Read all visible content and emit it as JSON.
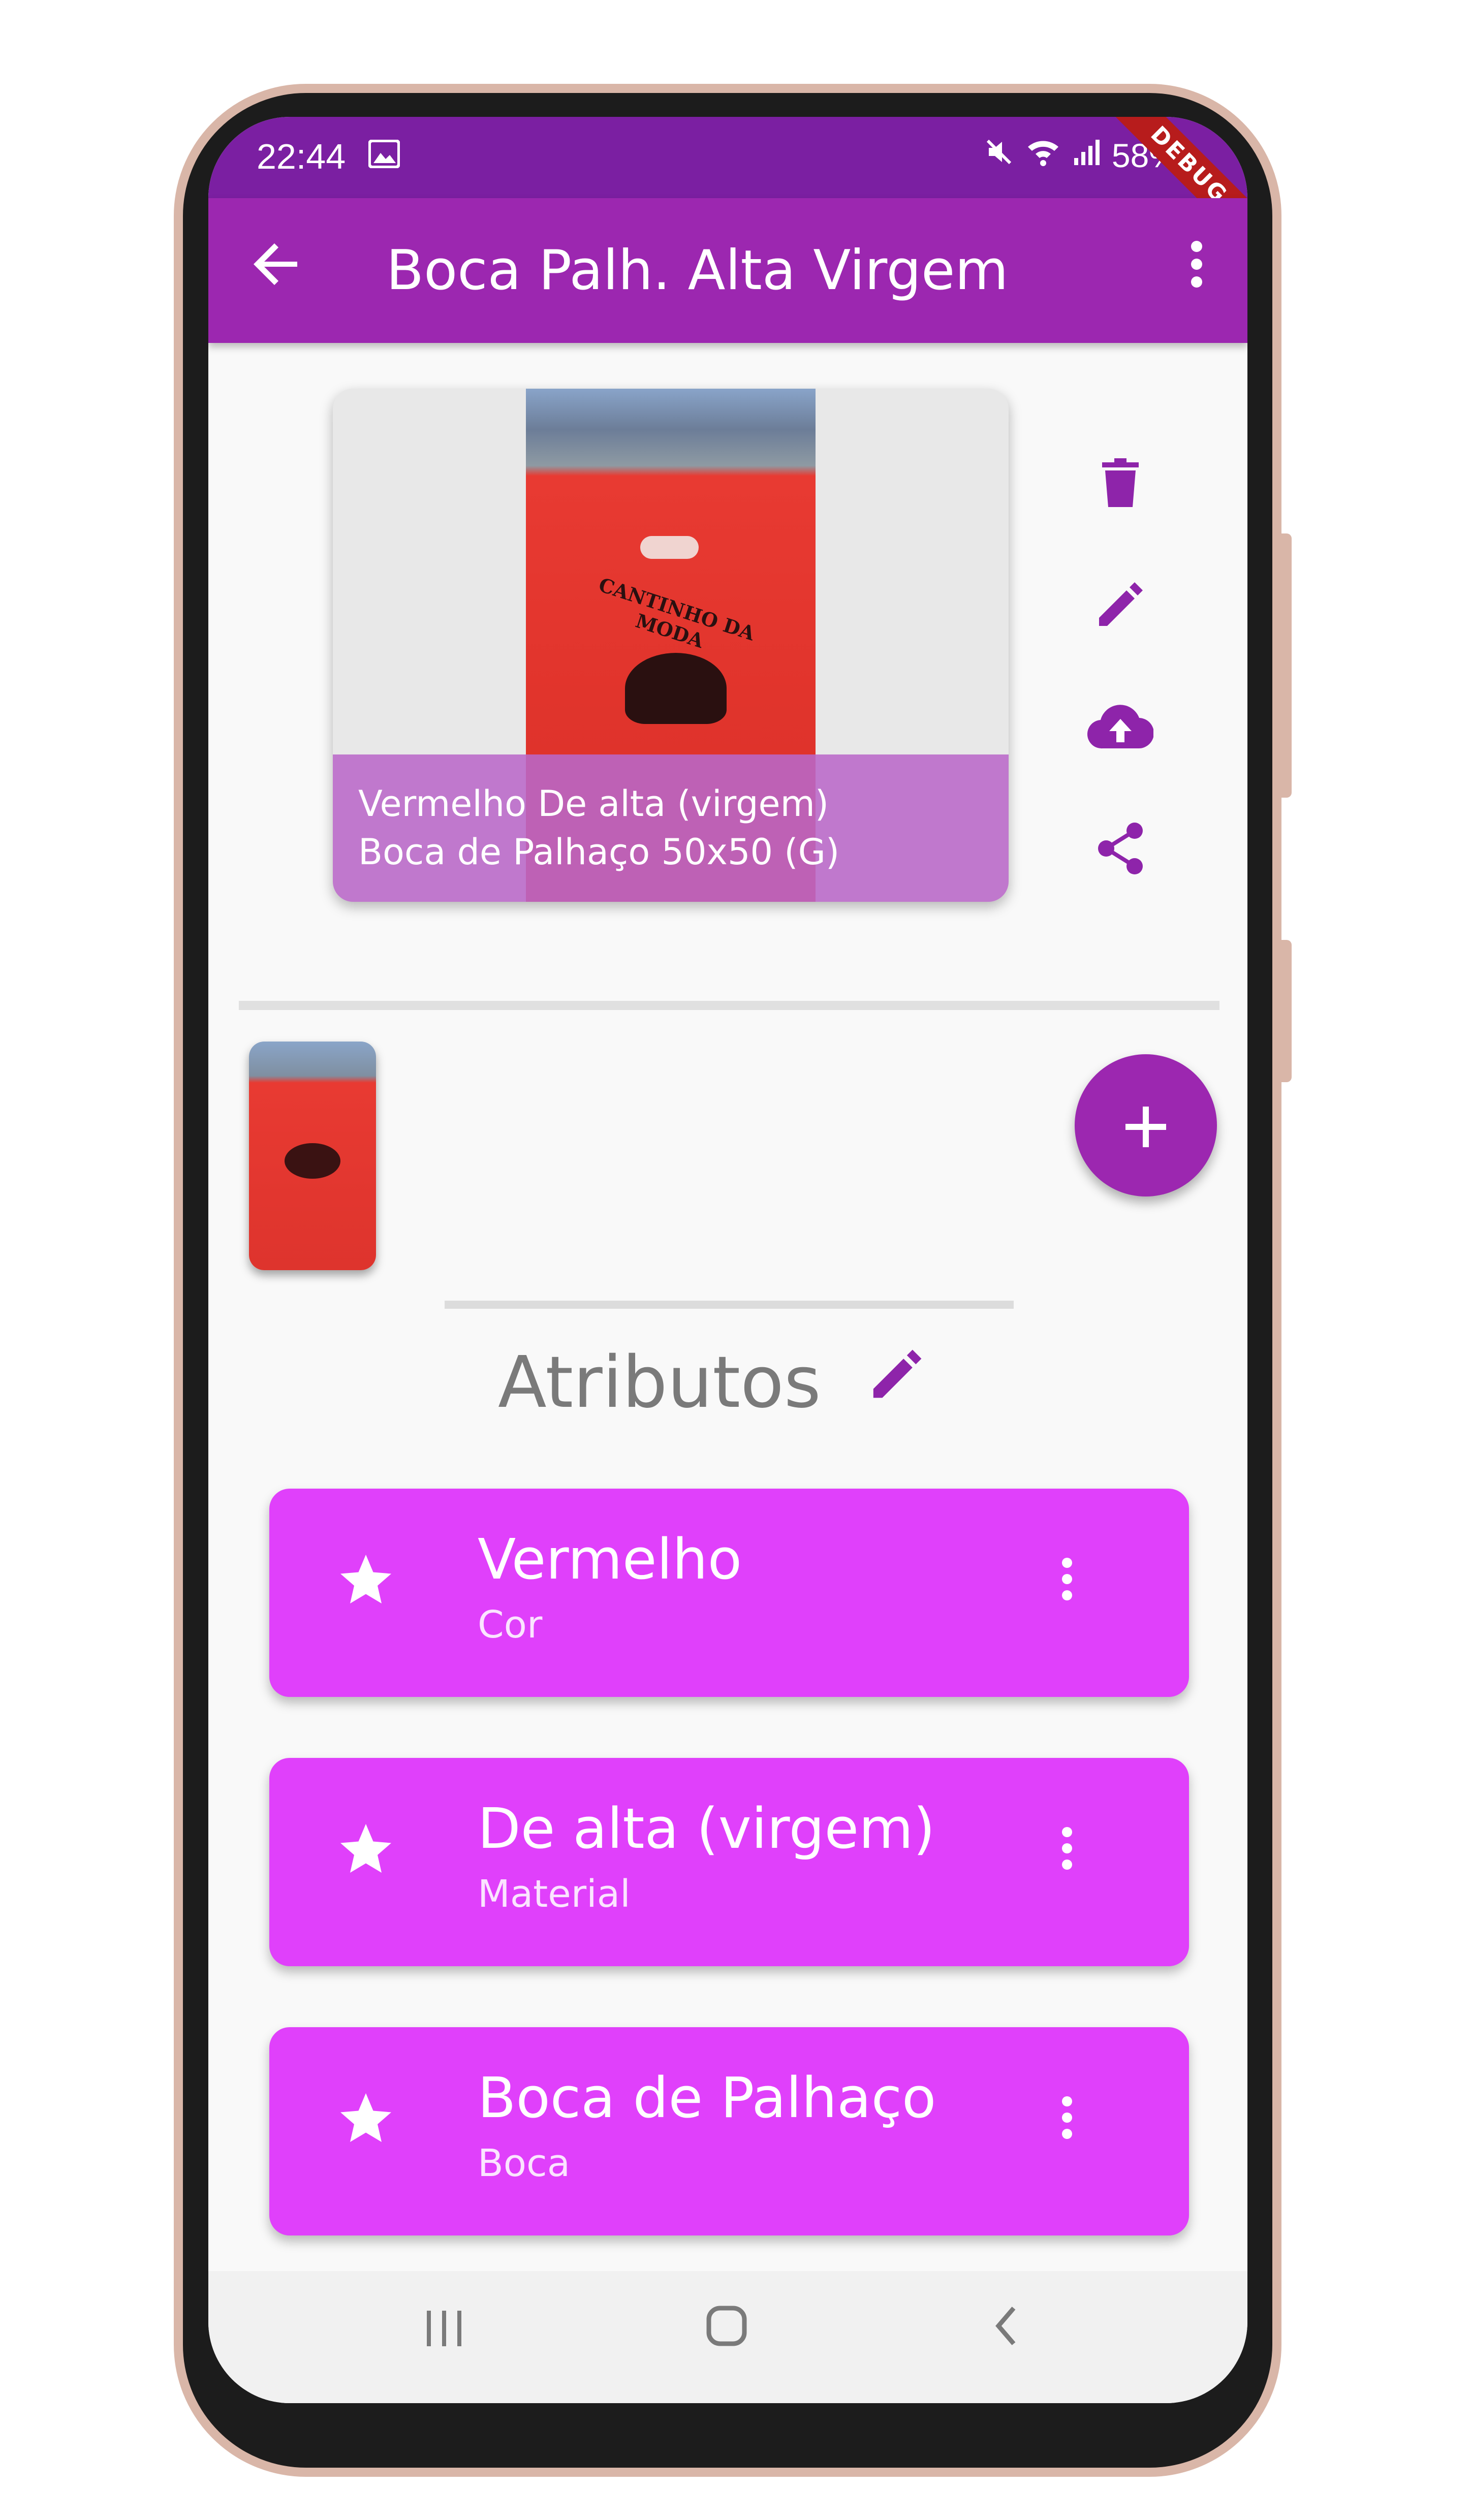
{
  "status_bar": {
    "time": "22:44",
    "battery": "58%",
    "debug_banner": "DEBUG"
  },
  "app_bar": {
    "title": "Boca Palh. Alta Virgem"
  },
  "product_image": {
    "caption_line1": "Vermelho De alta (virgem)",
    "caption_line2": "Boca de Palhaço 50x50 (G)",
    "logo_text": "CANTINHO DA MODA"
  },
  "section": {
    "title": "Atributos"
  },
  "attributes": [
    {
      "value": "Vermelho",
      "label": "Cor"
    },
    {
      "value": "De alta (virgem)",
      "label": "Material"
    },
    {
      "value": "Boca de Palhaço",
      "label": "Boca"
    }
  ],
  "colors": {
    "status_bar": "#7b1fa2",
    "app_bar": "#9c27b0",
    "accent_icon": "#8e24aa",
    "attribute_card": "#e040fb"
  }
}
